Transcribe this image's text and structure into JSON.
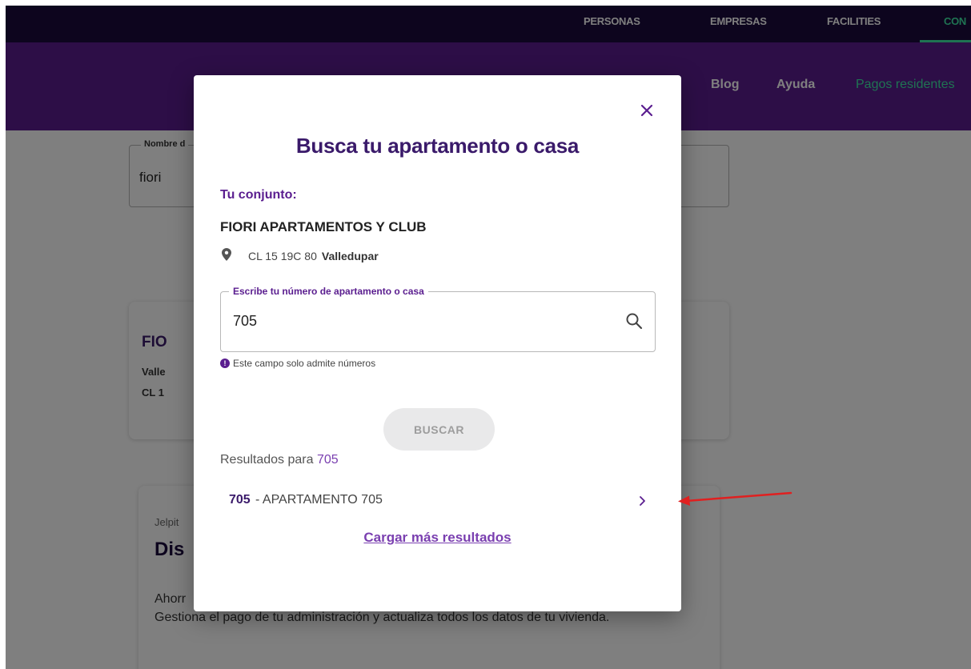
{
  "topnav": {
    "items": [
      "PERSONAS",
      "EMPRESAS",
      "FACILITIES",
      "CON"
    ],
    "active_index": 3
  },
  "subnav": {
    "items": [
      "Blog",
      "Ayuda"
    ],
    "highlight": "Pagos residentes"
  },
  "background": {
    "search_label": "Nombre d",
    "search_value": "fiori",
    "card1": {
      "title": "FIO",
      "city": "Valle",
      "address": "CL 1"
    },
    "card2": {
      "kicker": "Jelpit",
      "title": "Dis",
      "text": "Ahorr",
      "text2": "Gestiona el pago de tu administración y actualiza todos los datos de tu vivienda."
    }
  },
  "modal": {
    "title": "Busca tu apartamento o casa",
    "conjunto_label": "Tu conjunto:",
    "conjunto_name": "FIORI APARTAMENTOS Y CLUB",
    "address": "CL 15 19C 80",
    "city": "Valledupar",
    "field": {
      "legend": "Escribe tu número de apartamento o casa",
      "value": "705"
    },
    "hint": "Este campo solo admite números",
    "button_label": "BUSCAR",
    "results_prefix": "Resultados para",
    "results_query": "705",
    "results": [
      {
        "number": "705",
        "description": "- APARTAMENTO 705"
      }
    ],
    "load_more": "Cargar más resultados"
  },
  "colors": {
    "brand_purple": "#5a1d8f",
    "dark_navy": "#1a0a3c",
    "accent_green": "#3ee6a4",
    "annotation_red": "#e02020"
  }
}
